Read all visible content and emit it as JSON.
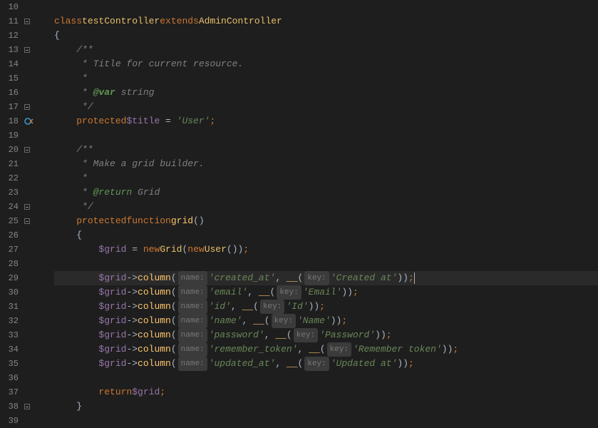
{
  "lines": {
    "l10": "",
    "l11": {
      "kw1": "class",
      "cls1": "testController",
      "kw2": "extends",
      "cls2": "AdminController"
    },
    "l12": "{",
    "l13": "/**",
    "l14": " * Title for current resource.",
    "l15": " *",
    "l16": {
      "pre": " * ",
      "tag": "@var",
      "post": " string"
    },
    "l17": " */",
    "l18": {
      "kw": "protected",
      "var": "$title",
      "eq": " = ",
      "str": "'User'",
      "semi": ";"
    },
    "l19": "",
    "l20": "/**",
    "l21": " * Make a grid builder.",
    "l22": " *",
    "l23": {
      "pre": " * ",
      "tag": "@return",
      "post": " Grid"
    },
    "l24": " */",
    "l25": {
      "kw1": "protected",
      "kw2": "function",
      "fn": "grid",
      "paren": "()"
    },
    "l26": "{",
    "l27": {
      "var": "$grid",
      "eq": " = ",
      "kw": "new",
      "cls": "Grid",
      "kw2": "new",
      "cls2": "User",
      "post": "());"
    },
    "l28": "",
    "l29": {
      "var": "$grid",
      "arrow": "->",
      "fn": "column",
      "hint1": "name:",
      "s1": "'created_at'",
      "fn2": "__",
      "hint2": "key:",
      "s2": "'Created at'",
      "tail": "));"
    },
    "l30": {
      "var": "$grid",
      "arrow": "->",
      "fn": "column",
      "hint1": "name:",
      "s1": "'email'",
      "fn2": "__",
      "hint2": "key:",
      "s2": "'Email'",
      "tail": "));"
    },
    "l31": {
      "var": "$grid",
      "arrow": "->",
      "fn": "column",
      "hint1": "name:",
      "s1": "'id'",
      "fn2": "__",
      "hint2": "key:",
      "s2": "'Id'",
      "tail": "));"
    },
    "l32": {
      "var": "$grid",
      "arrow": "->",
      "fn": "column",
      "hint1": "name:",
      "s1": "'name'",
      "fn2": "__",
      "hint2": "key:",
      "s2": "'Name'",
      "tail": "));"
    },
    "l33": {
      "var": "$grid",
      "arrow": "->",
      "fn": "column",
      "hint1": "name:",
      "s1": "'password'",
      "fn2": "__",
      "hint2": "key:",
      "s2": "'Password'",
      "tail": "));"
    },
    "l34": {
      "var": "$grid",
      "arrow": "->",
      "fn": "column",
      "hint1": "name:",
      "s1": "'remember_token'",
      "fn2": "__",
      "hint2": "key:",
      "s2": "'Remember token'",
      "tail": "));"
    },
    "l35": {
      "var": "$grid",
      "arrow": "->",
      "fn": "column",
      "hint1": "name:",
      "s1": "'updated_at'",
      "fn2": "__",
      "hint2": "key:",
      "s2": "'Updated at'",
      "tail": "));"
    },
    "l36": "",
    "l37": {
      "kw": "return",
      "var": "$grid",
      "semi": ";"
    },
    "l38": "}",
    "l39": ""
  },
  "gutter": {
    "start": 10,
    "end": 39,
    "folds": [
      11,
      13,
      17,
      20,
      24,
      25,
      38
    ]
  },
  "indent": {
    "i0": "",
    "i1": "    ",
    "i2": "        ",
    "i3": "            "
  },
  "common": {
    "comma": ", ",
    "lparen": "(",
    "rparen": ")",
    "semi": ";"
  }
}
